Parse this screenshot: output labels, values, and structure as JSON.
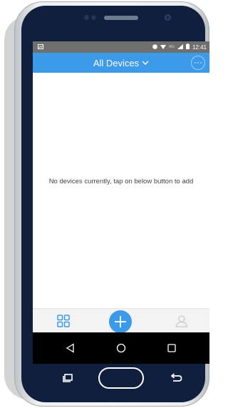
{
  "status_bar": {
    "time": "12:41",
    "network_label": "4G",
    "icons": [
      "image-icon",
      "record-icon",
      "wifi-icon",
      "signal-icon",
      "battery-icon"
    ]
  },
  "header": {
    "title": "All Devices",
    "dropdown_icon": "chevron-down-icon",
    "more_icon": "more-icon"
  },
  "main": {
    "empty_message": "No devices currently, tap on below button to add"
  },
  "tab_bar": {
    "left_icon": "devices-grid-icon",
    "center_icon": "add-icon",
    "right_icon": "profile-icon"
  },
  "nav_bar": {
    "icons": [
      "back-triangle-icon",
      "home-circle-icon",
      "recents-square-icon"
    ]
  },
  "colors": {
    "accent": "#3d9ae8",
    "phone_body": "#0f1f3d",
    "status_bar": "#6f6f6f",
    "nav_bar": "#000000"
  }
}
